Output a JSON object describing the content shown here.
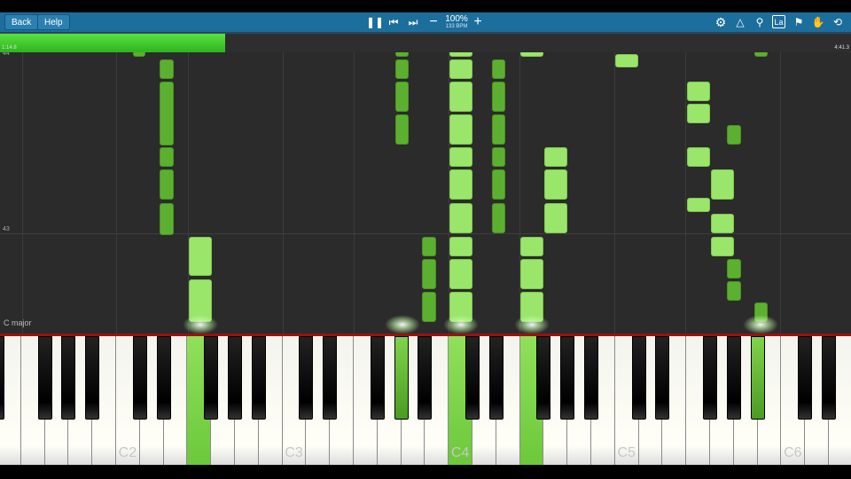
{
  "toolbar": {
    "back_label": "Back",
    "help_label": "Help",
    "speed_percent": "100%",
    "speed_bpm": "133 BPM",
    "icons": [
      "pause-icon",
      "skip-back-icon",
      "skip-forward-icon",
      "minus-icon",
      "plus-icon",
      "gear-icon",
      "metronome-icon",
      "magnifier-icon",
      "label-icon",
      "bookmark-icon",
      "hand-icon",
      "loop-icon"
    ]
  },
  "progress": {
    "elapsed": "1:14.8",
    "total": "4:41.3",
    "fraction": 0.265
  },
  "roll": {
    "measure_top": "44",
    "measure_mid": "43",
    "key_signature": "C major"
  },
  "keyboard": {
    "labels": [
      "C2",
      "C3",
      "C4",
      "C5",
      "C6"
    ]
  },
  "colors": {
    "toolbar": "#1c6e9c",
    "note_dark": "#5cb030",
    "note_light": "#9ae66a",
    "progress": "#3ccb28"
  }
}
